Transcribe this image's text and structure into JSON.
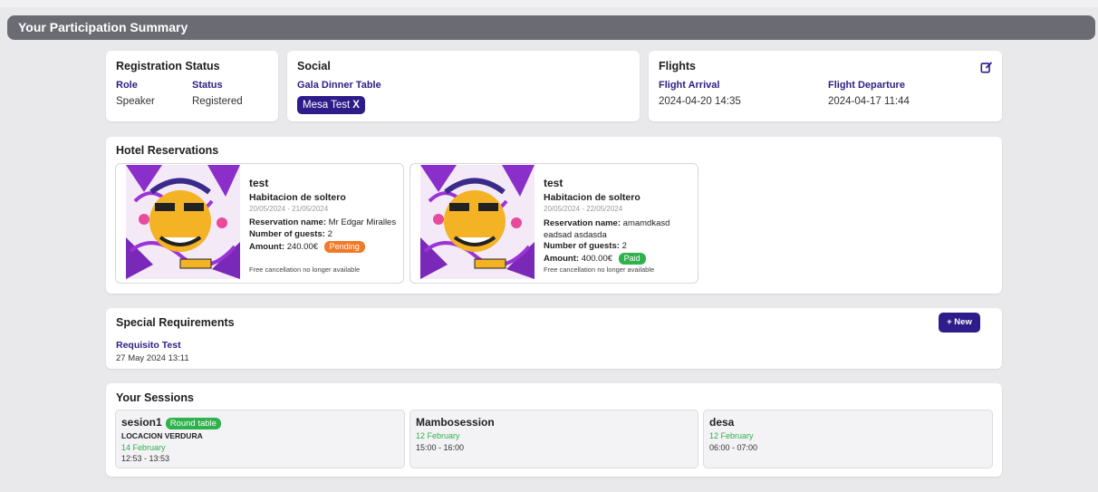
{
  "page": {
    "title": "Your Participation Summary"
  },
  "registration": {
    "title": "Registration Status",
    "role_label": "Role",
    "status_label": "Status",
    "role": "Speaker",
    "status": "Registered"
  },
  "social": {
    "title": "Social",
    "table_label": "Gala Dinner Table",
    "table_chip": "Mesa Test",
    "chip_remove": "X"
  },
  "flights": {
    "title": "Flights",
    "arrival_label": "Flight Arrival",
    "departure_label": "Flight Departure",
    "arrival": "2024-04-20 14:35",
    "departure": "2024-04-17 11:44",
    "edit_icon": "edit-icon"
  },
  "hotel": {
    "title": "Hotel Reservations",
    "reservations": [
      {
        "hotel": "test",
        "room": "Habitacion de soltero",
        "dates": "20/05/2024 - 21/05/2024",
        "name_label": "Reservation name:",
        "name": "Mr Edgar Miralles",
        "guests_label": "Number of guests:",
        "guests": "2",
        "amount_label": "Amount:",
        "amount": "240.00€",
        "status": "Pending",
        "status_color": "#f07a2a",
        "cancellation": "Free cancellation no longer available"
      },
      {
        "hotel": "test",
        "room": "Habitacion de soltero",
        "dates": "20/05/2024 - 22/05/2024",
        "name_label": "Reservation name:",
        "name": "amamdkasd eadsad asdasda",
        "guests_label": "Number of guests:",
        "guests": "2",
        "amount_label": "Amount:",
        "amount": "400.00€",
        "status": "Paid",
        "status_color": "#2fb14c",
        "cancellation": "Free cancellation no longer available"
      }
    ]
  },
  "requirements": {
    "title": "Special Requirements",
    "new_button": "+ New",
    "item_title": "Requisito Test",
    "item_date": "27 May 2024 13:11"
  },
  "sessions": {
    "title": "Your Sessions",
    "items": [
      {
        "name": "sesion1",
        "badge": "Round table",
        "location": "LOCACION VERDURA",
        "date": "14 February",
        "time": "12:53 - 13:53"
      },
      {
        "name": "Mambosession",
        "date": "12 February",
        "time": "15:00 - 16:00"
      },
      {
        "name": "desa",
        "date": "12 February",
        "time": "06:00 - 07:00"
      }
    ]
  },
  "colors": {
    "accent": "#2d1c8a",
    "title_bar": "#6b6b73",
    "pending": "#f07a2a",
    "paid": "#2fb14c"
  }
}
